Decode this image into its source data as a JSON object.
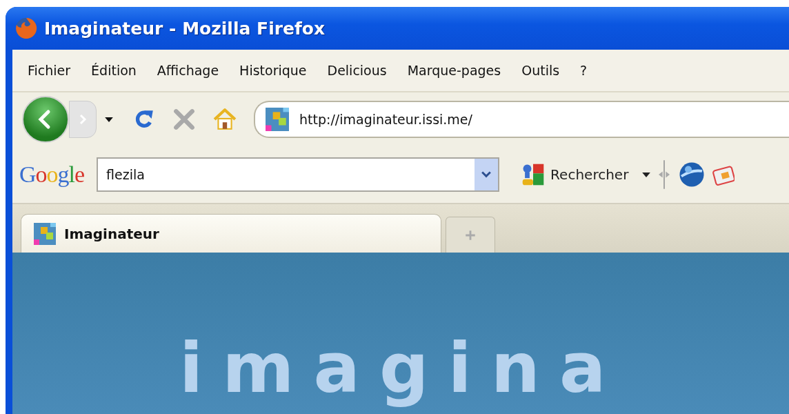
{
  "window": {
    "title": "Imaginateur - Mozilla Firefox"
  },
  "menu": [
    "Fichier",
    "Édition",
    "Affichage",
    "Historique",
    "Delicious",
    "Marque-pages",
    "Outils",
    "?"
  ],
  "navigation": {
    "forward_disabled": true,
    "stop_disabled": true,
    "url": "http://imaginateur.issi.me/"
  },
  "search_bar": {
    "logo": "Google",
    "value": "flezila",
    "button": "Rechercher"
  },
  "tabs": [
    {
      "label": "Imaginateur",
      "selected": true
    }
  ],
  "page": {
    "heading": "imagina"
  }
}
